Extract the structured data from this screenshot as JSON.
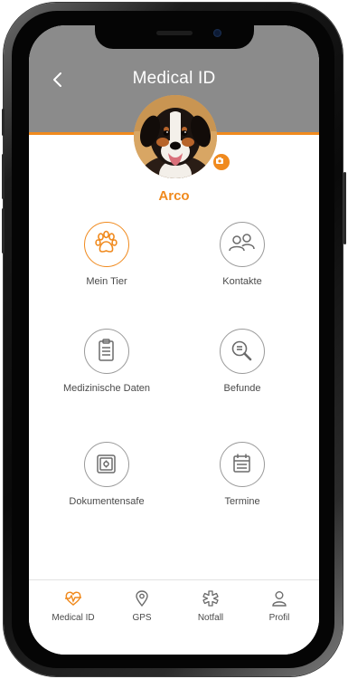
{
  "header": {
    "title": "Medical ID",
    "back_icon": "chevron-left-icon",
    "background": "#8b8b8b",
    "accent": "#f08a1e"
  },
  "pet": {
    "name": "Arco",
    "camera_icon": "camera-icon"
  },
  "menu": {
    "mein_tier": "Mein Tier",
    "kontakte": "Kontakte",
    "medizinische_daten": "Medizinische Daten",
    "befunde": "Befunde",
    "dokumentensafe": "Dokumentensafe",
    "termine": "Termine"
  },
  "bottom_nav": {
    "medical_id": "Medical ID",
    "gps": "GPS",
    "notfall": "Notfall",
    "profil": "Profil",
    "active": "Medical ID"
  }
}
